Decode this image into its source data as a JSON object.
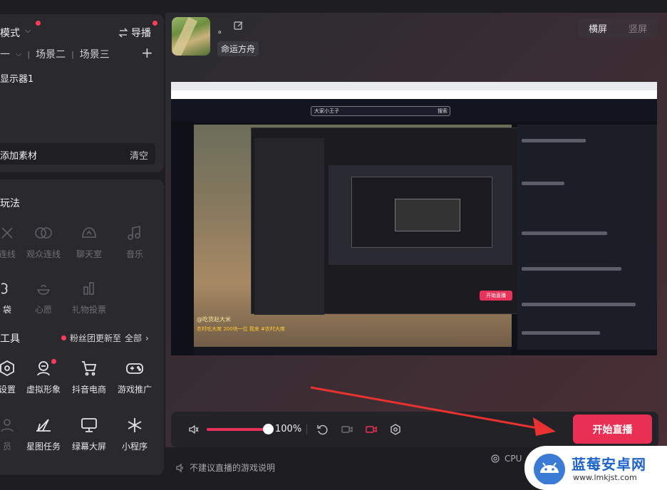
{
  "left_panel": {
    "mode_label": "模式",
    "director_label": "导播",
    "scenes": [
      "一",
      "场景二",
      "场景三"
    ],
    "monitor_label": "显示器1",
    "add_material": "添加素材",
    "clear_label": "清空"
  },
  "play": {
    "title": "玩法",
    "items": [
      {
        "label": "连线",
        "icon": "link-icon"
      },
      {
        "label": "观众连线",
        "icon": "audience-link-icon"
      },
      {
        "label": "聊天室",
        "icon": "chat-room-icon"
      },
      {
        "label": "音乐",
        "icon": "music-icon"
      },
      {
        "label": "袋",
        "icon": "bag-icon"
      },
      {
        "label": "心愿",
        "icon": "wish-icon"
      },
      {
        "label": "礼物投票",
        "icon": "gift-vote-icon"
      }
    ]
  },
  "tools": {
    "title": "工具",
    "fans_note": "粉丝团更新至",
    "all_label": "全部",
    "items": [
      {
        "label": "设置",
        "icon": "settings-icon"
      },
      {
        "label": "虚拟形象",
        "icon": "avatar-icon"
      },
      {
        "label": "抖音电商",
        "icon": "cart-icon"
      },
      {
        "label": "游戏推广",
        "icon": "gamepad-icon"
      },
      {
        "label": "员",
        "icon": "member-icon"
      },
      {
        "label": "星图任务",
        "icon": "star-map-icon"
      },
      {
        "label": "绿幕大屏",
        "icon": "monitor-icon"
      },
      {
        "label": "小程序",
        "icon": "mini-program-icon"
      }
    ]
  },
  "header": {
    "room_title": "。",
    "tag": "命运方舟",
    "landscape": "横屏",
    "portrait": "竖屏"
  },
  "stage": {
    "search_text": "大家小王子",
    "search_btn": "搜索",
    "caption1": "@吃货赵大米",
    "caption2": "农村吃大席 200块一位 我来 #农村大席",
    "inner_start": "开始直播"
  },
  "controls": {
    "volume": "100%",
    "volume_fraction": 0.9,
    "start_live": "开始直播",
    "game_note": "不建议直播的游戏说明",
    "cpu_label": "CPU"
  },
  "watermark": {
    "title": "蓝莓安卓网",
    "url": "www.lmkjst.com"
  },
  "colors": {
    "accent": "#ea2f55",
    "panel": "#2a2a2e",
    "watermark_blue": "#1e63c9"
  }
}
